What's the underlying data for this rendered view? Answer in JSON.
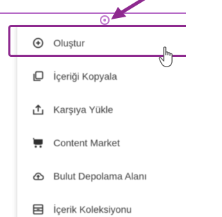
{
  "menu": {
    "items": [
      {
        "label": "Oluştur",
        "icon": "plus-circle-icon"
      },
      {
        "label": "İçeriği Kopyala",
        "icon": "copy-icon"
      },
      {
        "label": "Karşıya Yükle",
        "icon": "upload-icon"
      },
      {
        "label": "Content Market",
        "icon": "cart-icon"
      },
      {
        "label": "Bulut Depolama Alanı",
        "icon": "cloud-upload-icon"
      },
      {
        "label": "İçerik Koleksiyonu",
        "icon": "collection-icon"
      }
    ]
  },
  "colors": {
    "accent": "#8e2a8f",
    "line": "#b56ac6"
  }
}
